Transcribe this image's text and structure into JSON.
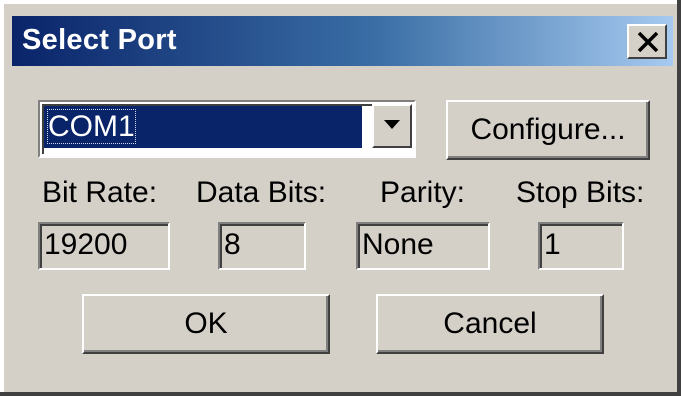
{
  "window": {
    "title": "Select Port",
    "close_glyph": "X"
  },
  "port": {
    "selected": "COM1",
    "dropdown_icon": "chevron-down-icon"
  },
  "buttons": {
    "configure": "Configure...",
    "ok": "OK",
    "cancel": "Cancel"
  },
  "settings": [
    {
      "label": "Bit Rate:",
      "value": "19200"
    },
    {
      "label": "Data Bits:",
      "value": "8"
    },
    {
      "label": "Parity:",
      "value": "None"
    },
    {
      "label": "Stop Bits:",
      "value": "1"
    }
  ],
  "colors": {
    "titlebar_start": "#0a246a",
    "titlebar_end": "#a6caf0",
    "dialog_bg": "#d4d0c8",
    "selection_bg": "#0a246a"
  }
}
